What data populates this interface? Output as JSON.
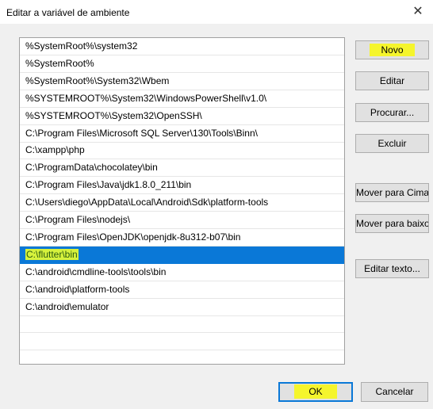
{
  "window": {
    "title": "Editar a variável de ambiente",
    "close_glyph": "✕"
  },
  "paths": [
    "%SystemRoot%\\system32",
    "%SystemRoot%",
    "%SystemRoot%\\System32\\Wbem",
    "%SYSTEMROOT%\\System32\\WindowsPowerShell\\v1.0\\",
    "%SYSTEMROOT%\\System32\\OpenSSH\\",
    "C:\\Program Files\\Microsoft SQL Server\\130\\Tools\\Binn\\",
    "C:\\xampp\\php",
    "C:\\ProgramData\\chocolatey\\bin",
    "C:\\Program Files\\Java\\jdk1.8.0_211\\bin",
    "C:\\Users\\diego\\AppData\\Local\\Android\\Sdk\\platform-tools",
    "C:\\Program Files\\nodejs\\",
    "C:\\Program Files\\OpenJDK\\openjdk-8u312-b07\\bin",
    "C:\\flutter\\bin",
    "C:\\android\\cmdline-tools\\tools\\bin",
    "C:\\android\\platform-tools",
    "C:\\android\\emulator"
  ],
  "selected_path": "C:\\flutter\\bin",
  "buttons": {
    "novo": "Novo",
    "editar": "Editar",
    "procurar": "Procurar...",
    "excluir": "Excluir",
    "mover_cima": "Mover para Cima",
    "mover_baixo": "Mover para baixo",
    "editar_texto": "Editar texto...",
    "ok": "OK",
    "cancelar": "Cancelar"
  },
  "colors": {
    "selection": "#0a78d7",
    "highlighter": "#f5f52c"
  }
}
